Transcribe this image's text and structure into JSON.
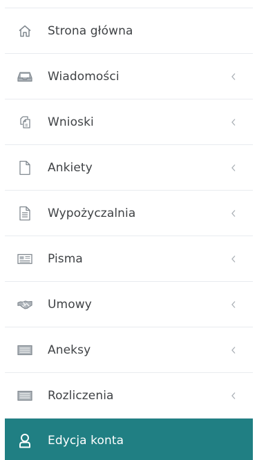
{
  "sidebar": {
    "items": [
      {
        "label": "Strona główna",
        "icon": "home-icon",
        "has_chevron": false
      },
      {
        "label": "Wiadomości",
        "icon": "inbox-icon",
        "has_chevron": true
      },
      {
        "label": "Wnioski",
        "icon": "copy-icon",
        "has_chevron": true
      },
      {
        "label": "Ankiety",
        "icon": "file-icon",
        "has_chevron": true
      },
      {
        "label": "Wypożyczalnia",
        "icon": "document-icon",
        "has_chevron": true
      },
      {
        "label": "Pisma",
        "icon": "newspaper-icon",
        "has_chevron": true
      },
      {
        "label": "Umowy",
        "icon": "handshake-icon",
        "has_chevron": true
      },
      {
        "label": "Aneksy",
        "icon": "keyboard-icon",
        "has_chevron": true
      },
      {
        "label": "Rozliczenia",
        "icon": "keyboard-icon",
        "has_chevron": true
      },
      {
        "label": "Edycja konta",
        "icon": "user-icon",
        "has_chevron": false,
        "active": true
      }
    ]
  },
  "colors": {
    "active_background": "#207f83",
    "text": "#3f4245",
    "icon": "#8a9299",
    "divider": "#e8ebef"
  }
}
